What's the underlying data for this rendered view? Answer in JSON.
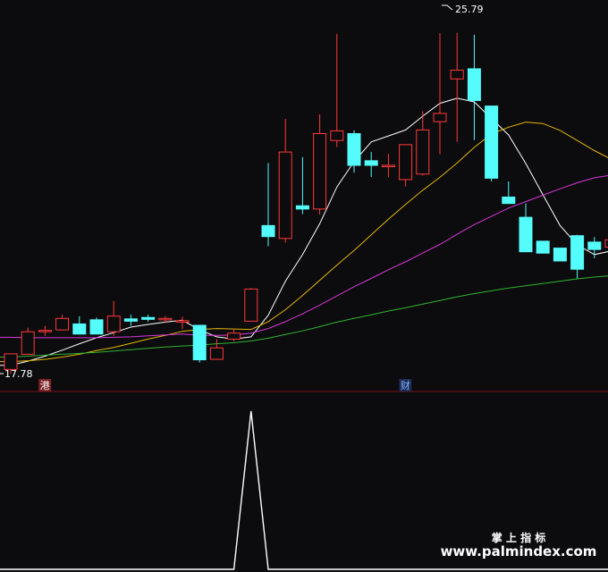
{
  "chart_data": {
    "type": "candlestick",
    "price_range": [
      17.78,
      25.79
    ],
    "labels": {
      "high": "25.79",
      "low": "17.78"
    },
    "markers": [
      {
        "text": "港",
        "index": 1,
        "bg": "#7a1f24",
        "fg": "#ffffff"
      },
      {
        "text": "财",
        "index": 22,
        "bg": "#1c2a55",
        "fg": "#7fb2ff"
      }
    ],
    "candles": [
      {
        "o": 17.87,
        "h": 18.14,
        "l": 17.78,
        "c": 18.21
      },
      {
        "o": 18.2,
        "h": 18.78,
        "l": 18.2,
        "c": 18.69
      },
      {
        "o": 18.7,
        "h": 18.82,
        "l": 18.6,
        "c": 18.72
      },
      {
        "o": 18.73,
        "h": 19.06,
        "l": 18.72,
        "c": 18.98
      },
      {
        "o": 18.86,
        "h": 19.03,
        "l": 18.63,
        "c": 18.64
      },
      {
        "o": 18.95,
        "h": 19.0,
        "l": 18.64,
        "c": 18.64
      },
      {
        "o": 18.69,
        "h": 19.36,
        "l": 18.6,
        "c": 19.03
      },
      {
        "o": 18.97,
        "h": 19.06,
        "l": 18.82,
        "c": 18.92
      },
      {
        "o": 19.0,
        "h": 19.06,
        "l": 18.91,
        "c": 18.96
      },
      {
        "o": 18.95,
        "h": 19.03,
        "l": 18.88,
        "c": 18.98
      },
      {
        "o": 18.9,
        "h": 19.02,
        "l": 18.75,
        "c": 18.93
      },
      {
        "o": 18.83,
        "h": 18.8,
        "l": 18.02,
        "c": 18.08
      },
      {
        "o": 18.09,
        "h": 18.53,
        "l": 18.09,
        "c": 18.34
      },
      {
        "o": 18.53,
        "h": 18.74,
        "l": 18.48,
        "c": 18.66
      },
      {
        "o": 18.92,
        "h": 19.64,
        "l": 18.92,
        "c": 19.62
      },
      {
        "o": 21.0,
        "h": 22.36,
        "l": 20.55,
        "c": 20.76
      },
      {
        "o": 20.72,
        "h": 23.32,
        "l": 20.63,
        "c": 22.6
      },
      {
        "o": 21.43,
        "h": 22.49,
        "l": 21.25,
        "c": 21.36
      },
      {
        "o": 21.36,
        "h": 23.42,
        "l": 21.24,
        "c": 23.0
      },
      {
        "o": 22.85,
        "h": 25.17,
        "l": 22.71,
        "c": 23.06
      },
      {
        "o": 23.0,
        "h": 23.07,
        "l": 22.15,
        "c": 22.31
      },
      {
        "o": 22.41,
        "h": 22.6,
        "l": 22.06,
        "c": 22.31
      },
      {
        "o": 22.28,
        "h": 22.56,
        "l": 22.05,
        "c": 22.31
      },
      {
        "o": 22.0,
        "h": 22.56,
        "l": 21.85,
        "c": 22.76
      },
      {
        "o": 22.12,
        "h": 23.49,
        "l": 22.09,
        "c": 23.08
      },
      {
        "o": 23.26,
        "h": 25.19,
        "l": 22.55,
        "c": 23.44
      },
      {
        "o": 24.19,
        "h": 25.19,
        "l": 22.82,
        "c": 24.38
      },
      {
        "o": 24.41,
        "h": 25.15,
        "l": 22.86,
        "c": 23.72
      },
      {
        "o": 23.6,
        "h": 23.0,
        "l": 21.96,
        "c": 22.03
      },
      {
        "o": 21.62,
        "h": 21.96,
        "l": 21.6,
        "c": 21.48
      },
      {
        "o": 21.18,
        "h": 21.48,
        "l": 20.43,
        "c": 20.43
      },
      {
        "o": 20.66,
        "h": 20.5,
        "l": 20.85,
        "c": 20.4
      },
      {
        "o": 20.51,
        "h": 20.51,
        "l": 20.23,
        "c": 20.23
      },
      {
        "o": 20.78,
        "h": 20.8,
        "l": 19.85,
        "c": 20.05
      },
      {
        "o": 20.64,
        "h": 20.75,
        "l": 20.29,
        "c": 20.48
      },
      {
        "o": 20.53,
        "h": 20.98,
        "l": 20.6,
        "c": 20.69
      }
    ],
    "ma_lines": [
      {
        "color": "#ffffff",
        "values": [
          17.96,
          18.05,
          18.16,
          18.29,
          18.43,
          18.56,
          18.67,
          18.79,
          18.85,
          18.9,
          18.94,
          18.73,
          18.58,
          18.53,
          18.58,
          19.05,
          19.79,
          20.37,
          21.04,
          21.84,
          22.39,
          22.82,
          22.95,
          23.08,
          23.38,
          23.66,
          23.77,
          23.69,
          23.33,
          22.97,
          22.35,
          21.67,
          21.0,
          20.58,
          20.37,
          20.45
        ]
      },
      {
        "color": "#e6b800",
        "values": [
          18.04,
          18.06,
          18.09,
          18.14,
          18.2,
          18.28,
          18.35,
          18.44,
          18.53,
          18.61,
          18.7,
          18.74,
          18.76,
          18.75,
          18.74,
          18.91,
          19.17,
          19.48,
          19.81,
          20.14,
          20.46,
          20.8,
          21.14,
          21.46,
          21.77,
          22.05,
          22.36,
          22.7,
          22.99,
          23.14,
          23.25,
          23.22,
          23.07,
          22.85,
          22.63,
          22.44
        ]
      },
      {
        "color": "#d838d8",
        "values": [
          18.57,
          18.56,
          18.56,
          18.56,
          18.56,
          18.56,
          18.57,
          18.58,
          18.6,
          18.62,
          18.64,
          18.61,
          18.61,
          18.62,
          18.66,
          18.76,
          18.91,
          19.08,
          19.27,
          19.47,
          19.67,
          19.85,
          20.04,
          20.21,
          20.4,
          20.59,
          20.81,
          21.02,
          21.2,
          21.38,
          21.52,
          21.66,
          21.8,
          21.93,
          22.04,
          22.1
        ]
      },
      {
        "color": "#2fb52f",
        "values": [
          18.14,
          18.16,
          18.18,
          18.2,
          18.22,
          18.24,
          18.27,
          18.3,
          18.33,
          18.36,
          18.38,
          18.4,
          18.43,
          18.45,
          18.49,
          18.55,
          18.63,
          18.71,
          18.8,
          18.9,
          18.98,
          19.06,
          19.14,
          19.21,
          19.29,
          19.37,
          19.45,
          19.52,
          19.58,
          19.64,
          19.69,
          19.74,
          19.79,
          19.84,
          19.88,
          19.91
        ]
      }
    ],
    "indicator": {
      "type": "line",
      "color": "#ffffff",
      "peak_index": 14,
      "values": [
        0,
        0,
        0,
        0,
        0,
        0,
        0,
        0,
        0,
        0,
        0,
        0,
        0,
        0,
        1,
        0,
        0,
        0,
        0,
        0,
        0,
        0,
        0,
        0,
        0,
        0,
        0,
        0,
        0,
        0,
        0,
        0,
        0,
        0,
        0,
        0
      ]
    },
    "colors": {
      "up": "#ff3a3a",
      "down": "#54fcfc",
      "background": "#0c0b0e",
      "divider": "#7a0f15",
      "label": "#ffffff"
    }
  },
  "watermark": {
    "line1": "掌 上 指 标",
    "line2": "www.palmindex.com"
  }
}
